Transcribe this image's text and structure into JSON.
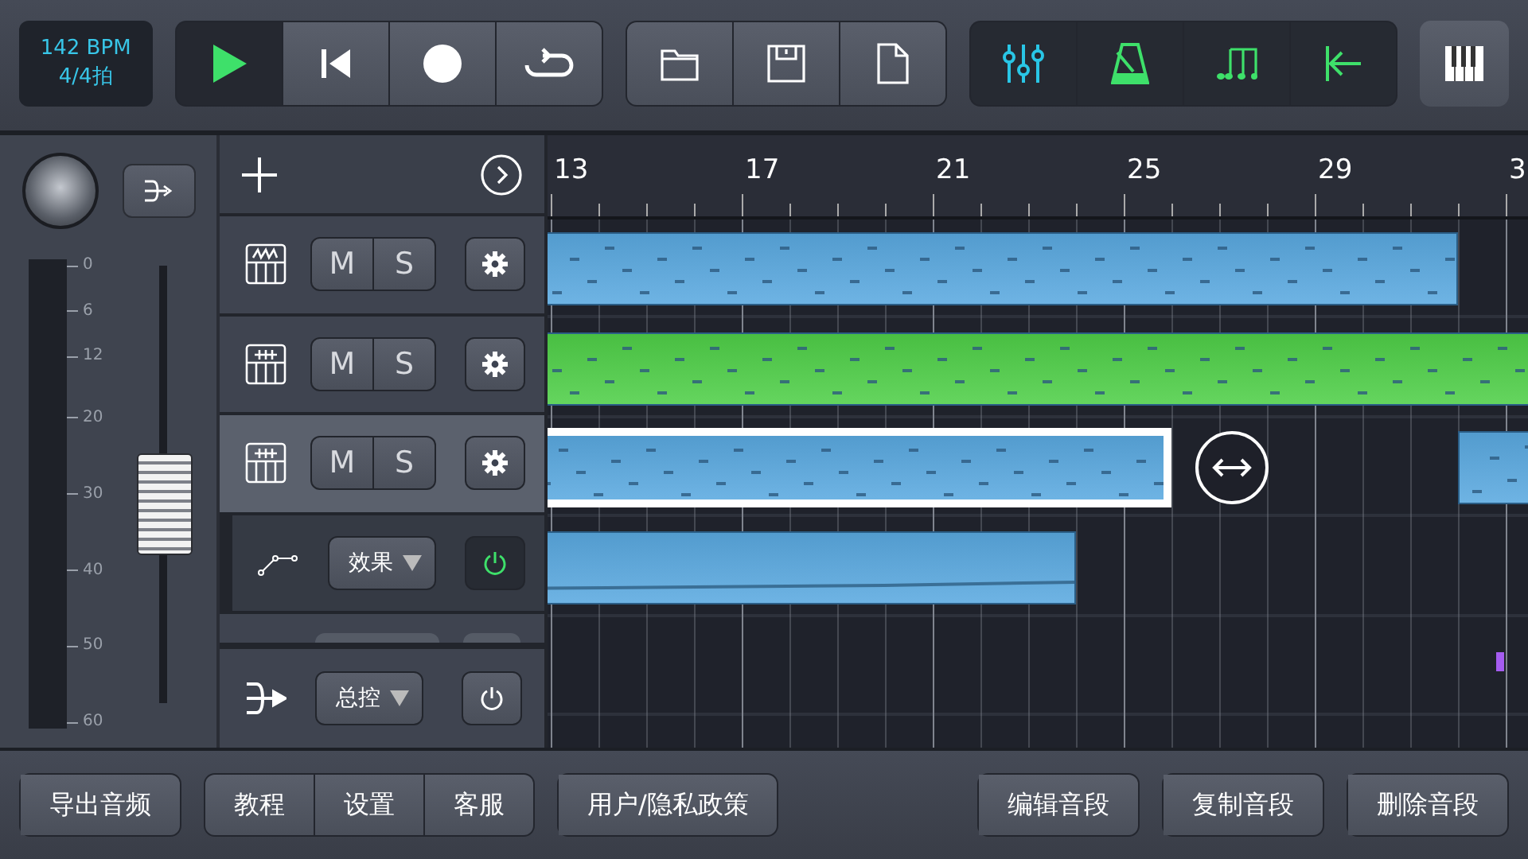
{
  "tempo": {
    "bpm": "142 BPM",
    "meter": "4/4拍"
  },
  "transport": [
    {
      "kind": "play",
      "selected": true
    },
    {
      "kind": "rewind",
      "selected": false
    },
    {
      "kind": "record",
      "selected": false
    },
    {
      "kind": "loop",
      "selected": false
    }
  ],
  "file_buttons": [
    {
      "kind": "open"
    },
    {
      "kind": "save"
    },
    {
      "kind": "new"
    }
  ],
  "tool_buttons": [
    {
      "kind": "mixer",
      "color": "#29c6e6"
    },
    {
      "kind": "metronome",
      "color": "#3ee06a"
    },
    {
      "kind": "notes",
      "color": "#3ee06a"
    },
    {
      "kind": "to-start",
      "color": "#3ee06a"
    }
  ],
  "mixer": {
    "level": 0.46,
    "scale": [
      "0",
      "6",
      "12",
      "20",
      "30",
      "40",
      "50",
      "60"
    ]
  },
  "tracks": [
    {
      "kind": "synth",
      "mute": "M",
      "solo": "S",
      "selected": false
    },
    {
      "kind": "keys",
      "mute": "M",
      "solo": "S",
      "selected": false
    },
    {
      "kind": "keys",
      "mute": "M",
      "solo": "S",
      "selected": true
    },
    {
      "kind": "effect",
      "label": "效果",
      "on": true
    },
    {
      "kind": "partial"
    }
  ],
  "master": {
    "label": "总控",
    "on": false
  },
  "ruler": [
    "13",
    "17",
    "21",
    "25",
    "29",
    "3"
  ],
  "clips": [
    {
      "color": "#5aa9e0",
      "selected": false,
      "kind": "notes"
    },
    {
      "color": "#4fcf48",
      "selected": false,
      "kind": "notes"
    },
    {
      "color": "#5aa9e0",
      "selected": true,
      "kind": "notes"
    },
    {
      "color": "#5aa9e0",
      "selected": false,
      "kind": "notes"
    },
    {
      "color": "#5aa9e0",
      "selected": false,
      "kind": "automation"
    },
    {
      "color": "#a55cf0",
      "kind": "marker"
    }
  ],
  "bottom_groups": [
    [
      "导出音频"
    ],
    [
      "教程",
      "设置",
      "客服"
    ],
    [
      "用户/隐私政策"
    ],
    [
      "编辑音段"
    ],
    [
      "复制音段"
    ],
    [
      "删除音段"
    ]
  ]
}
